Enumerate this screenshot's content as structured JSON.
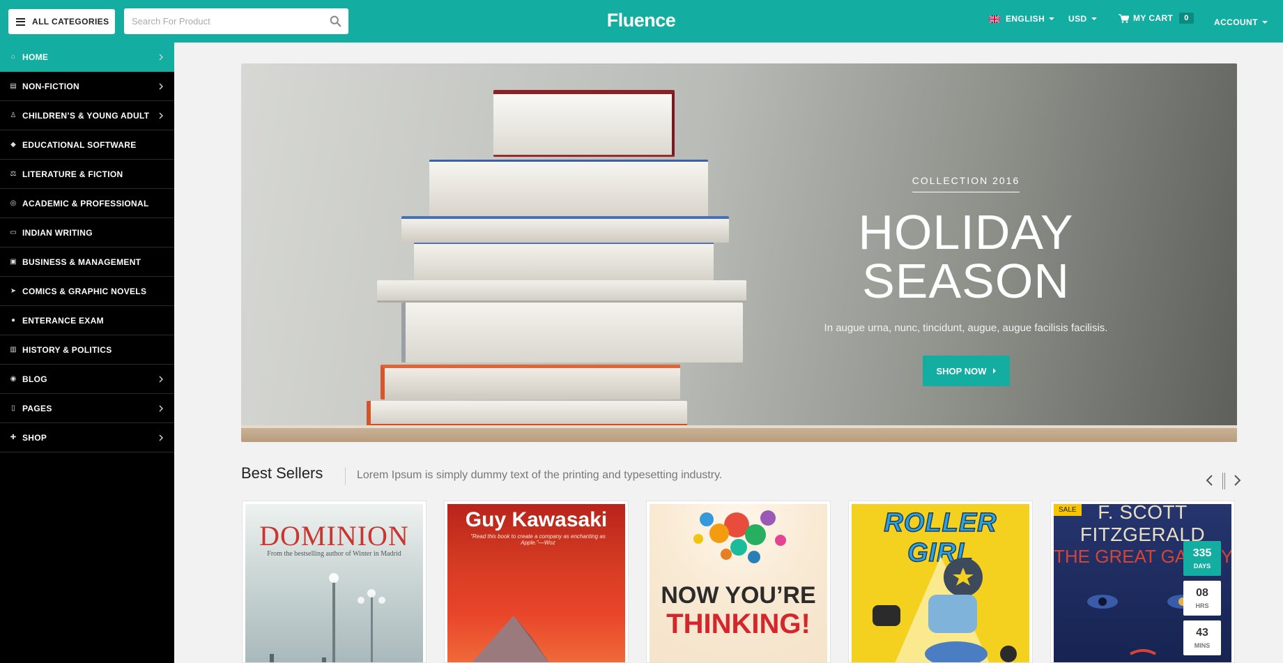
{
  "header": {
    "all_categories": "ALL CATEGORIES",
    "search_placeholder": "Search For Product",
    "logo": "Fluence",
    "language": "ENGLISH",
    "currency": "USD",
    "cart_label": "MY CART",
    "cart_count": "0",
    "account": "ACCOUNT"
  },
  "sidebar": {
    "items": [
      {
        "label": "HOME",
        "icon": "home-icon",
        "active": true,
        "has_submenu": true
      },
      {
        "label": "NON-FICTION",
        "icon": "book-icon",
        "has_submenu": true
      },
      {
        "label": "CHILDREN’S & YOUNG ADULT",
        "icon": "child-icon",
        "has_submenu": true
      },
      {
        "label": "EDUCATIONAL SOFTWARE",
        "icon": "graduation-cap-icon",
        "has_submenu": false
      },
      {
        "label": "LITERATURE & FICTION",
        "icon": "balance-scale-icon",
        "has_submenu": false
      },
      {
        "label": "ACADEMIC & PROFESSIONAL",
        "icon": "compass-icon",
        "has_submenu": false
      },
      {
        "label": "INDIAN WRITING",
        "icon": "desktop-icon",
        "has_submenu": false
      },
      {
        "label": "BUSINESS & MANAGEMENT",
        "icon": "briefcase-icon",
        "has_submenu": false
      },
      {
        "label": "COMICS & GRAPHIC NOVELS",
        "icon": "paper-plane-icon",
        "has_submenu": false
      },
      {
        "label": "ENTERANCE EXAM",
        "icon": "user-icon",
        "has_submenu": false
      },
      {
        "label": "HISTORY & POLITICS",
        "icon": "institution-icon",
        "has_submenu": false
      },
      {
        "label": "BLOG",
        "icon": "rss-icon",
        "has_submenu": true
      },
      {
        "label": "PAGES",
        "icon": "file-icon",
        "has_submenu": true
      },
      {
        "label": "SHOP",
        "icon": "gift-icon",
        "has_submenu": true
      }
    ]
  },
  "hero": {
    "collection": "COLLECTION 2016",
    "title": "HOLIDAY SEASON",
    "subtitle": "In augue urna, nunc, tincidunt, augue, augue facilisis facilisis.",
    "button": "SHOP NOW"
  },
  "best_sellers": {
    "title": "Best Sellers",
    "description": "Lorem Ipsum is simply dummy text of the printing and typesetting industry.",
    "products": [
      {
        "cover_title": "DOMINION",
        "cover_sub": "From the bestselling author of Winter in Madrid"
      },
      {
        "cover_title": "Guy Kawasaki",
        "cover_sub": "\"Read this book to create a company as enchanting as Apple.\"—Woz"
      },
      {
        "cover_title_1": "NOW YOU’RE",
        "cover_title_2": "THINKING!"
      },
      {
        "cover_title": "ROLLER GIRL"
      },
      {
        "badge": "SALE",
        "cover_author": "F. SCOTT FITZGERALD",
        "cover_title": "THE GREAT GATSBY",
        "countdown": [
          {
            "value": "335",
            "unit": "DAYS"
          },
          {
            "value": "08",
            "unit": "HRS"
          },
          {
            "value": "43",
            "unit": "MINS"
          }
        ]
      }
    ]
  },
  "colors": {
    "accent": "#14ada1",
    "sidebar_bg": "#000000",
    "page_bg": "#f2f2f2"
  }
}
